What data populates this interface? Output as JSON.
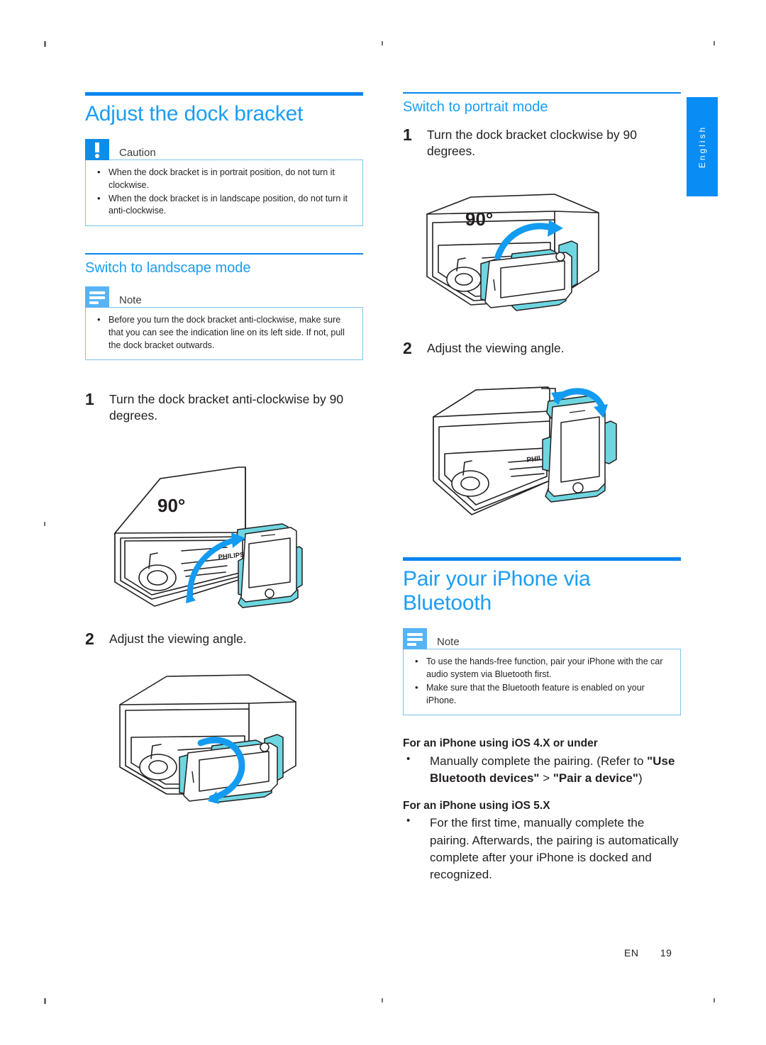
{
  "page": {
    "language_tab": "English",
    "footer_locale": "EN",
    "footer_page": "19"
  },
  "left_column": {
    "chapter_title": "Adjust the dock bracket",
    "caution": {
      "icon": "exclamation-icon",
      "label": "Caution",
      "items": [
        "When the dock bracket is in portrait position, do not turn it clockwise.",
        "When the dock bracket is in landscape position, do not turn it anti-clockwise."
      ]
    },
    "section_title": "Switch to landscape mode",
    "note": {
      "icon": "note-lines-icon",
      "label": "Note",
      "items": [
        "Before you turn the dock bracket anti-clockwise, make sure that you can see the indication line on its left side. If not, pull the dock bracket outwards."
      ]
    },
    "steps": [
      {
        "num": "1",
        "text": "Turn the dock bracket anti-clockwise by 90 degrees."
      },
      {
        "num": "2",
        "text": "Adjust the viewing angle."
      }
    ],
    "figure_1_label": "90°",
    "figure_1_brand": "PHILIPS",
    "figure_2_label": ""
  },
  "right_column": {
    "section_title": "Switch to portrait mode",
    "steps": [
      {
        "num": "1",
        "text": "Turn the dock bracket clockwise by 90 degrees."
      },
      {
        "num": "2",
        "text": "Adjust the viewing angle."
      }
    ],
    "figure_1_label": "90°",
    "figure_2_brand": "PHILIPS",
    "chapter_title_line1": "Pair your iPhone via",
    "chapter_title_line2": "Bluetooth",
    "note": {
      "icon": "note-lines-icon",
      "label": "Note",
      "items": [
        "To use the hands-free function, pair your iPhone with the car audio system via Bluetooth first.",
        "Make sure that the Bluetooth feature is enabled on your iPhone."
      ]
    },
    "ios4": {
      "heading": "For an iPhone using iOS 4.X or under",
      "bullet_prefix": "Manually complete the pairing. (Refer to ",
      "bullet_bold_1": "\"Use Bluetooth devices\"",
      "bullet_mid": " > ",
      "bullet_bold_2": "\"Pair a device\"",
      "bullet_suffix": ")"
    },
    "ios5": {
      "heading": "For an iPhone using iOS 5.X",
      "bullet": "For the first time, manually complete the pairing. Afterwards, the pairing is automatically complete after your iPhone is docked and recognized."
    }
  },
  "colors": {
    "heading_blue": "#1b9df4",
    "rule_blue": "#0a84f0",
    "caution_badge": "#0e8de8",
    "note_badge": "#56b4f5",
    "box_border": "#7cc3f0",
    "illustration_accent": "#6ed6e0",
    "illustration_arrow": "#129bf0",
    "text": "#231f20"
  }
}
